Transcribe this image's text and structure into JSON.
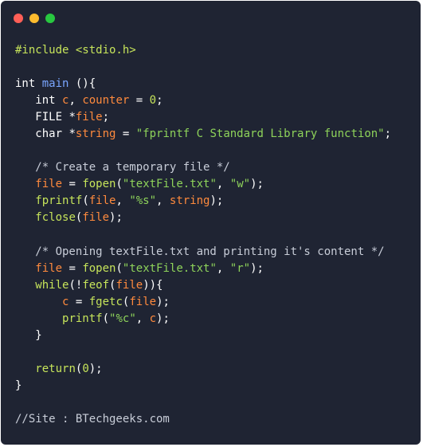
{
  "window": {
    "buttons": [
      "close",
      "minimize",
      "maximize"
    ]
  },
  "code": {
    "language": "C",
    "lines": [
      "#include <stdio.h>",
      "",
      "int main (){",
      "   int c, counter = 0;",
      "   FILE *file;",
      "   char *string = \"fprintf C Standard Library function\";",
      "",
      "   /* Create a temporary file */",
      "   file = fopen(\"textFile.txt\", \"w\");",
      "   fprintf(file, \"%s\", string);",
      "   fclose(file);",
      "",
      "   /* Opening textFile.txt and printing it's content */",
      "   file = fopen(\"textFile.txt\", \"r\");",
      "   while(!feof(file)){",
      "       c = fgetc(file);",
      "       printf(\"%c\", c);",
      "   }",
      "",
      "   return(0);",
      "}",
      "",
      "//Site : BTechgeeks.com"
    ]
  },
  "colors": {
    "background": "#1f2433",
    "keyword": "#c6e45a",
    "variable": "#ff8a3d",
    "string": "#8ed35a",
    "function_name": "#7aa6ff",
    "comment": "#c8cdd8"
  }
}
